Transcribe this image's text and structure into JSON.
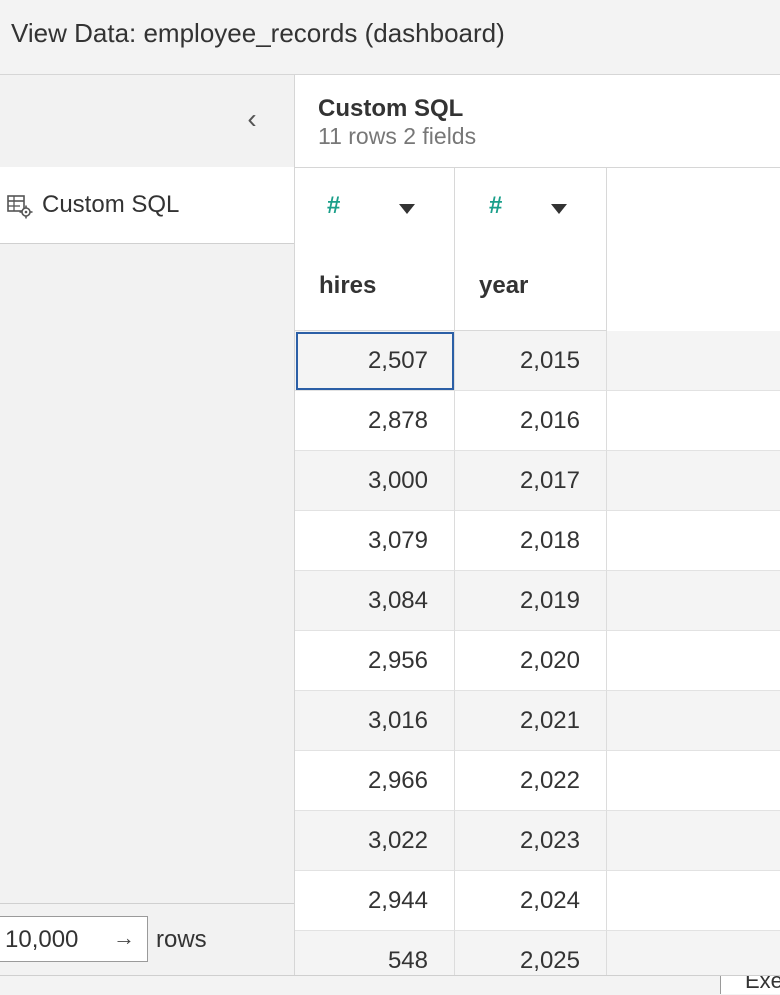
{
  "window": {
    "title": "View Data: employee_records (dashboard)"
  },
  "sidebar": {
    "collapse_icon": "chevron-left-icon",
    "source": {
      "icon": "table-settings-icon",
      "label": "Custom SQL"
    },
    "row_limit": {
      "value": "10,000",
      "apply_icon": "arrow-right-icon",
      "label": "rows"
    }
  },
  "table": {
    "name": "Custom SQL",
    "meta": "11 rows  2 fields",
    "columns": [
      {
        "type_icon": "number-hash-icon",
        "name": "hires"
      },
      {
        "type_icon": "number-hash-icon",
        "name": "year"
      }
    ],
    "rows": [
      [
        "2,507",
        "2,015"
      ],
      [
        "2,878",
        "2,016"
      ],
      [
        "3,000",
        "2,017"
      ],
      [
        "3,079",
        "2,018"
      ],
      [
        "3,084",
        "2,019"
      ],
      [
        "2,956",
        "2,020"
      ],
      [
        "3,016",
        "2,021"
      ],
      [
        "2,966",
        "2,022"
      ],
      [
        "3,022",
        "2,023"
      ],
      [
        "2,944",
        "2,024"
      ],
      [
        "548",
        "2,025"
      ]
    ]
  },
  "footer": {
    "button_partial": "Exe"
  },
  "colors": {
    "accent_type": "#1a9f8a",
    "selection": "#2b5fa6"
  }
}
